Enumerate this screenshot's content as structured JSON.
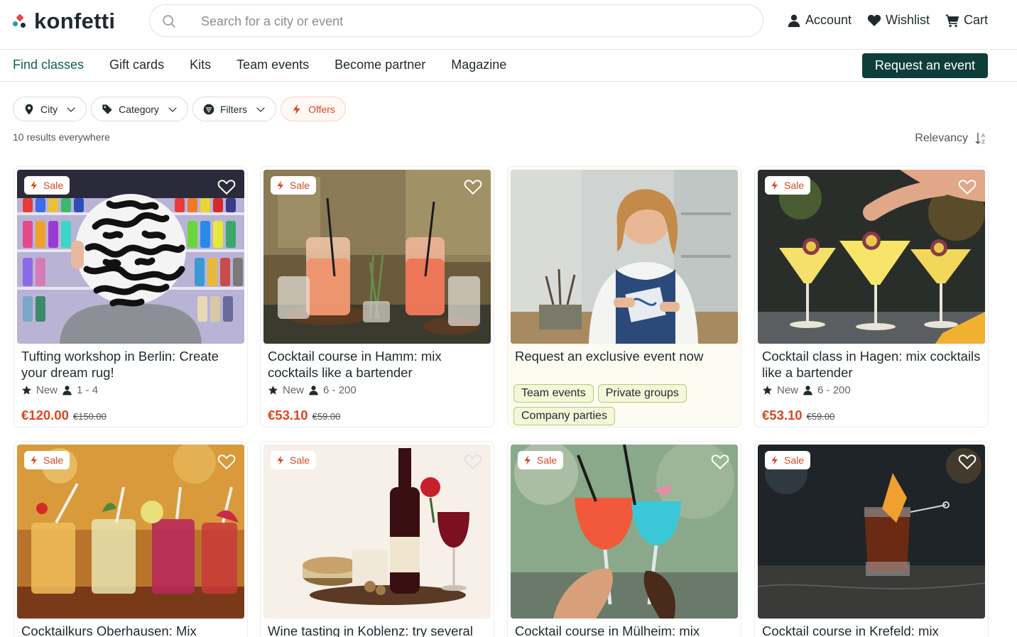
{
  "brand": {
    "name": "konfetti"
  },
  "search": {
    "placeholder": "Search for a city or event"
  },
  "top_actions": [
    {
      "label": "Account",
      "icon": "user-icon"
    },
    {
      "label": "Wishlist",
      "icon": "heart-icon"
    },
    {
      "label": "Cart",
      "icon": "cart-icon"
    }
  ],
  "nav": {
    "links": [
      "Find classes",
      "Gift cards",
      "Kits",
      "Team events",
      "Become partner",
      "Magazine"
    ],
    "active": "Find classes",
    "cta": "Request an event"
  },
  "filters": {
    "city": "City",
    "category": "Category",
    "filters": "Filters",
    "offers": "Offers"
  },
  "results_text": "10 results everywhere",
  "sort": {
    "label": "Relevancy"
  },
  "colors": {
    "accent": "#0f5e58",
    "cta_bg": "#0f3e3a",
    "sale": "#d9481f",
    "tag_bg": "#f4f7d8"
  },
  "cards": [
    {
      "badge": "Sale",
      "title": "Tufting workshop in Berlin: Create your dream rug!",
      "meta_new": "New",
      "meta_people": "1 - 4",
      "price": "€120.00",
      "old_price": "€150.00"
    },
    {
      "badge": "Sale",
      "title": "Cocktail course in Hamm: mix cocktails like a bartender",
      "meta_new": "New",
      "meta_people": "6 - 200",
      "price": "€53.10",
      "old_price": "€59.00"
    },
    {
      "title": "Request an exclusive event now",
      "tags": [
        "Team events",
        "Private groups",
        "Company parties"
      ]
    },
    {
      "badge": "Sale",
      "title": "Cocktail class in Hagen: mix cocktails like a bartender",
      "meta_new": "New",
      "meta_people": "6 - 200",
      "price": "€53.10",
      "old_price": "€59.00"
    },
    {
      "badge": "Sale",
      "title": "Cocktailkurs Oberhausen: Mix"
    },
    {
      "badge": "Sale",
      "title": "Wine tasting in Koblenz: try several"
    },
    {
      "badge": "Sale",
      "title": "Cocktail course in Mülheim: mix"
    },
    {
      "badge": "Sale",
      "title": "Cocktail course in Krefeld: mix"
    }
  ]
}
